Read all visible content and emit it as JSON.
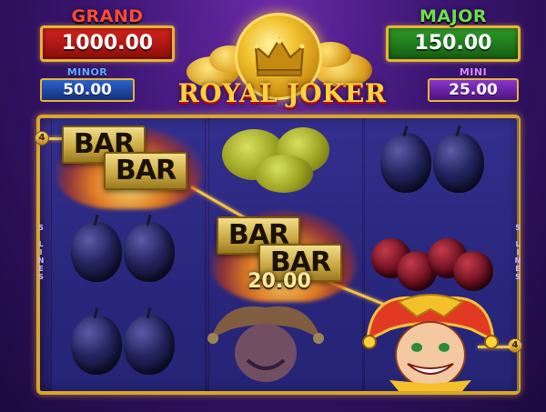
{
  "jackpots": {
    "grand": {
      "label": "GRAND",
      "value": "1000.00"
    },
    "major": {
      "label": "MAJOR",
      "value": "150.00"
    },
    "minor": {
      "label": "MINOR",
      "value": "50.00"
    },
    "mini": {
      "label": "MINI",
      "value": "25.00"
    }
  },
  "logo": {
    "title": "ROYAL JOKER"
  },
  "lines": {
    "left_marker": "4",
    "right_marker": "4",
    "left_label": "5 LINES",
    "right_label": "5 LINES"
  },
  "reels": [
    {
      "symbols": [
        "bar-icon",
        "plum-icon",
        "plum-icon"
      ]
    },
    {
      "symbols": [
        "lemon-icon",
        "bar-icon",
        "joker-icon"
      ]
    },
    {
      "symbols": [
        "plum-icon",
        "cherry-icon",
        "joker-icon"
      ]
    }
  ],
  "bar_text": "BAR",
  "win": {
    "amount": "20.00"
  },
  "colors": {
    "grand": "#d4231e",
    "major": "#2e9a2a",
    "minor": "#2b62d0",
    "mini": "#8a35d0",
    "frame_gold": "#d9a52a",
    "background": "#3a1570"
  }
}
